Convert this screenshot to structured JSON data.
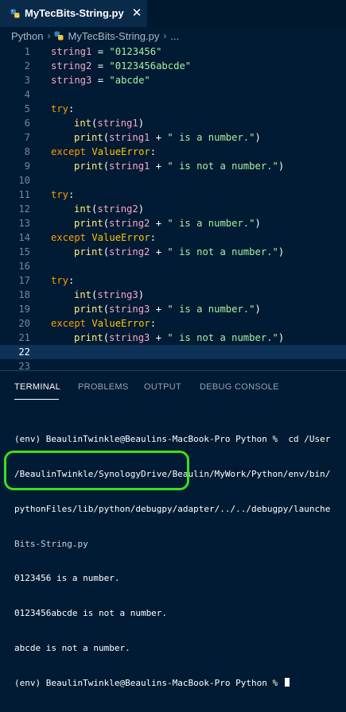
{
  "tab": {
    "title": "MyTecBits-String.py",
    "close_glyph": "✕"
  },
  "breadcrumb": {
    "items": [
      "Python",
      "MyTecBits-String.py",
      "..."
    ],
    "separator": "›"
  },
  "editor": {
    "current_line": 22,
    "lines": [
      {
        "n": "1"
      },
      {
        "n": "2"
      },
      {
        "n": "3"
      },
      {
        "n": "4"
      },
      {
        "n": "5"
      },
      {
        "n": "6"
      },
      {
        "n": "7"
      },
      {
        "n": "8"
      },
      {
        "n": "9"
      },
      {
        "n": "10"
      },
      {
        "n": "11"
      },
      {
        "n": "12"
      },
      {
        "n": "13"
      },
      {
        "n": "14"
      },
      {
        "n": "15"
      },
      {
        "n": "16"
      },
      {
        "n": "17"
      },
      {
        "n": "18"
      },
      {
        "n": "19"
      },
      {
        "n": "20"
      },
      {
        "n": "21"
      },
      {
        "n": "22"
      },
      {
        "n": "23"
      }
    ],
    "tokens": {
      "string1": "string1",
      "string2": "string2",
      "string3": "string3",
      "eq": " = ",
      "val1": "\"0123456\"",
      "val2": "\"0123456abcde\"",
      "val3": "\"abcde\"",
      "try": "try",
      "colon": ":",
      "int": "int",
      "print": "print",
      "lparen": "(",
      "rparen": ")",
      "plus": " + ",
      "is_number": "\" is a number.\"",
      "not_number": "\" is not a number.\"",
      "except": "except",
      "valueerror": "ValueError"
    }
  },
  "panel": {
    "tabs": [
      "TERMINAL",
      "PROBLEMS",
      "OUTPUT",
      "DEBUG CONSOLE"
    ],
    "active_tab": "TERMINAL",
    "terminal_lines": [
      "(env) BeaulinTwinkle@Beaulins-MacBook-Pro Python %  cd /User",
      "/BeaulinTwinkle/SynologyDrive/Beaulin/MyWork/Python/env/bin/",
      "pythonFiles/lib/python/debugpy/adapter/../../debugpy/launche",
      "Bits-String.py",
      "0123456 is a number.",
      "0123456abcde is not a number.",
      "abcde is not a number.",
      "(env) BeaulinTwinkle@Beaulins-MacBook-Pro Python % "
    ]
  },
  "colors": {
    "highlight_ring": "#39e020",
    "background": "#001b33"
  }
}
